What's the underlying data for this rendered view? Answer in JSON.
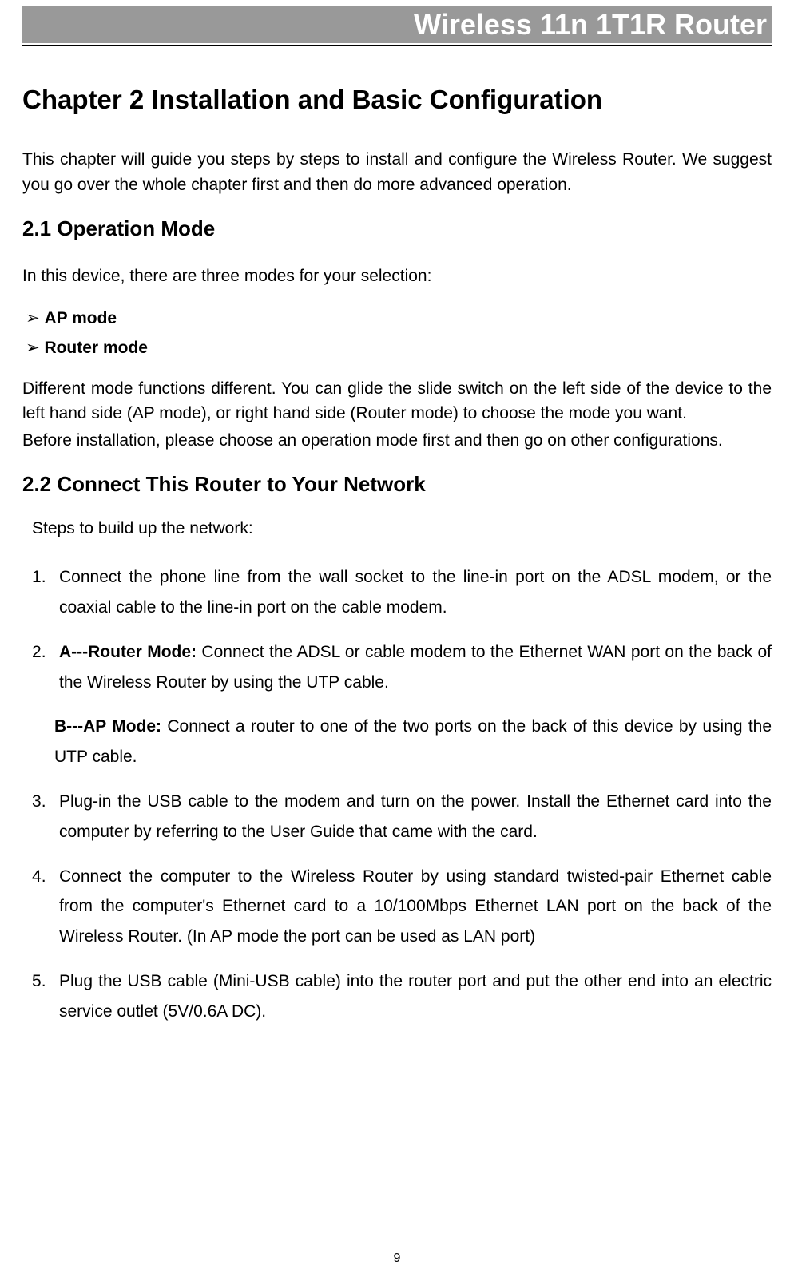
{
  "header": {
    "title": "Wireless 11n 1T1R Router"
  },
  "chapter": {
    "title": "Chapter 2    Installation and Basic Configuration",
    "intro": "This chapter will guide you steps by steps to install and configure the Wireless Router. We suggest you go over the whole chapter first and then do more advanced operation."
  },
  "section21": {
    "title": "2.1    Operation Mode",
    "intro": "In this device, there are three modes for your selection:",
    "bullets": {
      "b1": "AP mode",
      "b2": "Router mode"
    },
    "para1": "Different mode functions different. You can glide the slide switch on the left side of the device to the left hand side (AP mode), or right hand side (Router mode) to choose the mode you want.",
    "para2": "Before installation, please choose an operation mode first and then go on other configurations."
  },
  "section22": {
    "title": "2.2    Connect This Router to Your Network",
    "intro": "Steps to build up the network:",
    "steps": {
      "s1": "Connect the phone line from the wall socket to the line-in port on the ADSL modem, or the coaxial cable to the line-in port on the cable modem.",
      "s2_label_a": "A---Router Mode:",
      "s2_a": " Connect the ADSL or cable modem to the Ethernet WAN port on the back of the Wireless Router by using the UTP cable.",
      "s2_label_b": "B---AP Mode:",
      "s2_b": " Connect a router to one of the two ports on the back of this device by using the UTP cable.",
      "s3": "Plug-in the USB cable to the modem and turn on the power. Install the Ethernet card into the computer by referring to the User Guide that came with the card.",
      "s4": "Connect the computer to the Wireless Router by using standard twisted-pair Ethernet cable from the computer's Ethernet card to a 10/100Mbps Ethernet LAN port on the back of the Wireless Router. (In AP mode the port can be used as LAN port)",
      "s5": "Plug the USB cable (Mini-USB cable) into the router port and put the other end into an electric service outlet (5V/0.6A DC)."
    }
  },
  "page": "9"
}
